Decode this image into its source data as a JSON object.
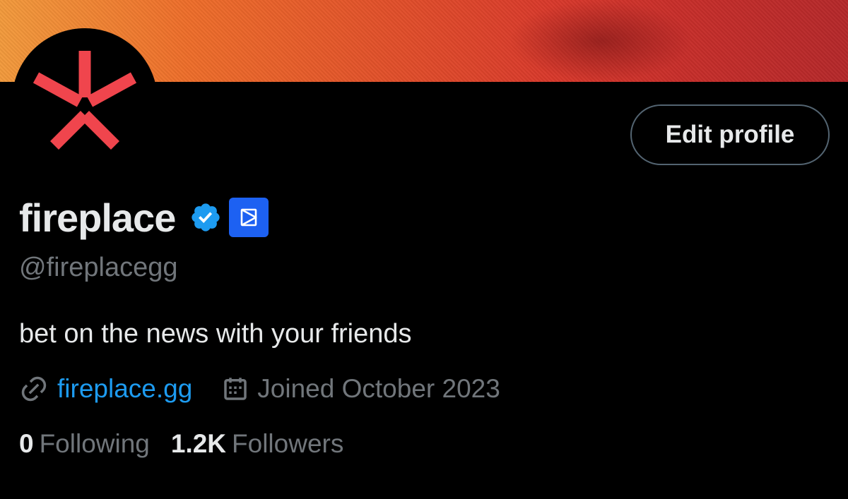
{
  "profile": {
    "display_name": "fireplace",
    "handle": "@fireplacegg",
    "bio": "bet on the news with your friends",
    "website": "fireplace.gg",
    "joined": "Joined October 2023",
    "edit_label": "Edit profile",
    "following_count": "0",
    "following_label": "Following",
    "followers_count": "1.2K",
    "followers_label": "Followers"
  },
  "icons": {
    "avatar_logo": "asterisk-logo-icon",
    "verified": "verified-badge-icon",
    "affiliate": "affiliate-badge-icon",
    "link": "link-icon",
    "calendar": "calendar-icon"
  },
  "colors": {
    "background": "#000000",
    "text_primary": "#e7e9ea",
    "text_secondary": "#71767b",
    "link": "#1d9bf0",
    "verified": "#1d9bf0",
    "affiliate_badge": "#1d61f2",
    "logo": "#f0454d",
    "button_border": "#536471"
  }
}
